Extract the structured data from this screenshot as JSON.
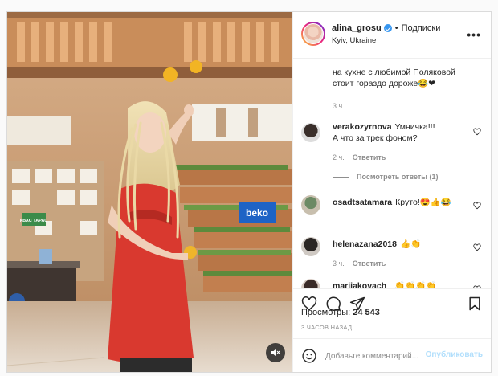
{
  "post": {
    "username": "alina_grosu",
    "follow_status": "Подписки",
    "dot": "•",
    "location": "Kyiv, Ukraine",
    "more_icon": "more-horizontal-icon"
  },
  "caption": {
    "line1": "на кухне с любимой Поляковой",
    "line2": "стоит гораздо дороже😂❤",
    "time": "3 ч."
  },
  "comments": [
    {
      "user": "verakozyrnova",
      "text": "Умничка!!!",
      "text2": "А что за трек фоном?",
      "time": "2 ч.",
      "reply": "Ответить",
      "view_replies": "Посмотреть ответы (1)"
    },
    {
      "user": "osadtsatamara",
      "text": "Крутo!😍👍😂"
    },
    {
      "user": "helenazana2018",
      "text": "👍👏",
      "time": "3 ч.",
      "reply": "Ответить"
    },
    {
      "user": "marijakovach_",
      "text": "👏👏👏👏"
    }
  ],
  "stats": {
    "views_label": "Просмотры:",
    "views_count": "24 543",
    "time_ago": "3 ЧАСОВ НАЗАД"
  },
  "composer": {
    "placeholder": "Добавьте комментарий...",
    "publish_label": "Опубликовать"
  },
  "scene": {
    "sign_beko": "beko",
    "sign_kvas": "КВАС ТАРАС"
  },
  "colors": {
    "accent_blue": "#3897f0",
    "publish_disabled": "#b2dffc",
    "apron_red": "#d9392f",
    "like_red": "#ed4956"
  }
}
